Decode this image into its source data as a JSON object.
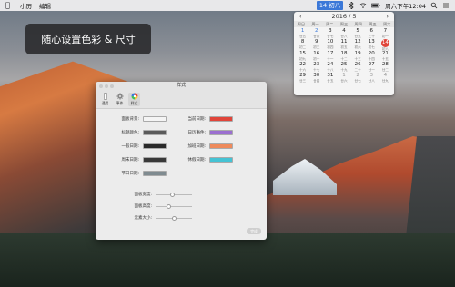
{
  "menubar": {
    "app_name": "小历",
    "edit_menu": "编辑",
    "calendar_badge": "14 初八",
    "clock": "周六下午12:04"
  },
  "banner": {
    "text": "随心设置色彩 & 尺寸"
  },
  "calendar": {
    "title": "2016 / 5",
    "prev": "‹",
    "next": "›",
    "weekdays": [
      "周日",
      "周一",
      "周二",
      "周三",
      "周四",
      "周五",
      "周六"
    ],
    "days": [
      {
        "n": "1",
        "l": "廿五",
        "c": "hl"
      },
      {
        "n": "2",
        "l": "廿六",
        "c": "hl"
      },
      {
        "n": "3",
        "l": "廿七",
        "c": ""
      },
      {
        "n": "4",
        "l": "廿八",
        "c": ""
      },
      {
        "n": "5",
        "l": "廿九",
        "c": ""
      },
      {
        "n": "6",
        "l": "三十",
        "c": ""
      },
      {
        "n": "7",
        "l": "初一",
        "c": ""
      },
      {
        "n": "8",
        "l": "初二",
        "c": ""
      },
      {
        "n": "9",
        "l": "初三",
        "c": ""
      },
      {
        "n": "10",
        "l": "初四",
        "c": ""
      },
      {
        "n": "11",
        "l": "初五",
        "c": ""
      },
      {
        "n": "12",
        "l": "初六",
        "c": ""
      },
      {
        "n": "13",
        "l": "初七",
        "c": ""
      },
      {
        "n": "14",
        "l": "初八",
        "c": "today"
      },
      {
        "n": "15",
        "l": "初九",
        "c": ""
      },
      {
        "n": "16",
        "l": "初十",
        "c": ""
      },
      {
        "n": "17",
        "l": "十一",
        "c": ""
      },
      {
        "n": "18",
        "l": "十二",
        "c": ""
      },
      {
        "n": "19",
        "l": "十三",
        "c": ""
      },
      {
        "n": "20",
        "l": "十四",
        "c": ""
      },
      {
        "n": "21",
        "l": "十五",
        "c": ""
      },
      {
        "n": "22",
        "l": "十六",
        "c": ""
      },
      {
        "n": "23",
        "l": "十七",
        "c": ""
      },
      {
        "n": "24",
        "l": "十八",
        "c": ""
      },
      {
        "n": "25",
        "l": "十九",
        "c": ""
      },
      {
        "n": "26",
        "l": "二十",
        "c": ""
      },
      {
        "n": "27",
        "l": "廿一",
        "c": ""
      },
      {
        "n": "28",
        "l": "廿二",
        "c": ""
      },
      {
        "n": "29",
        "l": "廿三",
        "c": ""
      },
      {
        "n": "30",
        "l": "廿四",
        "c": ""
      },
      {
        "n": "31",
        "l": "廿五",
        "c": ""
      },
      {
        "n": "1",
        "l": "廿六",
        "c": "dim"
      },
      {
        "n": "2",
        "l": "廿七",
        "c": "dim"
      },
      {
        "n": "3",
        "l": "廿八",
        "c": "dim"
      },
      {
        "n": "4",
        "l": "廿九",
        "c": "dim"
      }
    ]
  },
  "prefs": {
    "title": "样式",
    "tabs": [
      {
        "label": "通用",
        "icon": "phone-icon"
      },
      {
        "label": "事件",
        "icon": "gear-icon"
      },
      {
        "label": "样式",
        "icon": "color-wheel-icon"
      }
    ],
    "color_rows": [
      {
        "left": "面板背景:",
        "left_color": "#f4f4f4",
        "right": "当前日期:",
        "right_color": "#e0453a"
      },
      {
        "left": "标题颜色:",
        "left_color": "#5a5a5a",
        "right": "日历事件:",
        "right_color": "#9b6fd0"
      },
      {
        "left": "一般日期:",
        "left_color": "#2a2a2a",
        "right": "加班日期:",
        "right_color": "#ee8a5c"
      },
      {
        "left": "周末日期:",
        "left_color": "#3a3a3a",
        "right": "休假日期:",
        "right_color": "#45c3d4"
      },
      {
        "left": "节日日期:",
        "left_color": "#7f8b90"
      }
    ],
    "sliders": [
      {
        "label": "面板宽度:",
        "value": 0.45
      },
      {
        "label": "面板高度:",
        "value": 0.35
      },
      {
        "label": "元素大小:",
        "value": 0.5
      }
    ],
    "ok_label": "完成"
  }
}
